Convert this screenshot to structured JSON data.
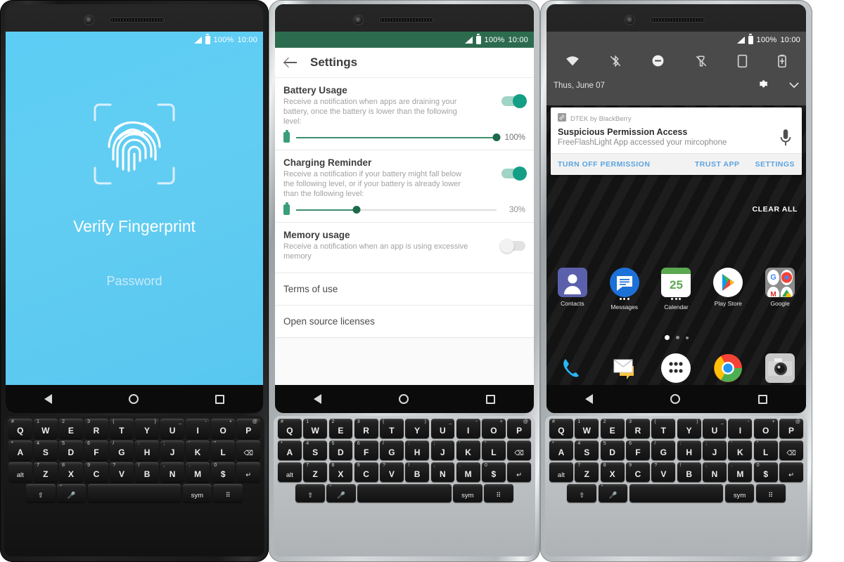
{
  "phones": [
    {
      "id": "phone-lockscreen",
      "finish": "black",
      "statusbar": {
        "battery_percent": "100%",
        "time": "10:00"
      },
      "screen": {
        "type": "lockscreen",
        "icon": "fingerprint-icon",
        "title": "Verify Fingerprint",
        "password_link": "Password",
        "background_color": "#5ccdf5"
      }
    },
    {
      "id": "phone-settings",
      "finish": "silver",
      "statusbar": {
        "battery_percent": "100%",
        "time": "10:00",
        "bar_color": "#2d6b4f"
      },
      "screen": {
        "type": "settings",
        "appbar": {
          "back_icon": "arrow-back-icon",
          "title": "Settings"
        },
        "items": [
          {
            "title": "Battery Usage",
            "description": "Receive a notification when apps are draining your battery, once the battery is lower than the following level:",
            "toggle": "on",
            "slider": {
              "value": 100,
              "label": "100%"
            }
          },
          {
            "title": "Charging Reminder",
            "description": "Receive a notification if your battery might fall below the following level, or if your battery is already lower than the following level:",
            "toggle": "on",
            "slider": {
              "value": 30,
              "label": "30%"
            }
          },
          {
            "title": "Memory usage",
            "description": "Receive a notification when an app is using excessive memory",
            "toggle": "off"
          }
        ],
        "links": [
          "Terms of use",
          "Open source licenses"
        ]
      }
    },
    {
      "id": "phone-notification-shade",
      "finish": "silver",
      "statusbar": {
        "battery_percent": "100%",
        "time": "10:00"
      },
      "screen": {
        "type": "home-with-shade",
        "quick_settings": {
          "icons": [
            "wifi-icon",
            "bluetooth-off-icon",
            "do-not-disturb-icon",
            "flashlight-off-icon",
            "auto-rotate-icon",
            "battery-saver-icon"
          ],
          "date": "Thus, June 07",
          "settings_icon": "gear-icon",
          "expand_icon": "chevron-down-icon"
        },
        "notification": {
          "app_icon": "dtek-icon",
          "app_name": "DTEK by BlackBerry",
          "title": "Suspicious Permission Access",
          "text": "FreeFlashLight App accessed your mircophone",
          "large_icon": "microphone-icon",
          "actions": [
            "TURN OFF PERMISSION",
            "TRUST APP",
            "SETTINGS"
          ]
        },
        "clear_all": "CLEAR ALL",
        "apps_row1": [
          {
            "label": "Contacts",
            "icon": "contacts-icon",
            "badge": false
          },
          {
            "label": "Messages",
            "icon": "messages-icon",
            "badge": true
          },
          {
            "label": "Calendar",
            "icon": "calendar-icon",
            "badge": true,
            "day": "25"
          },
          {
            "label": "Play Store",
            "icon": "play-store-icon",
            "badge": false
          },
          {
            "label": "Google",
            "icon": "google-folder-icon",
            "badge": false
          }
        ],
        "dock": [
          {
            "label": "",
            "icon": "phone-icon",
            "badge": false
          },
          {
            "label": "",
            "icon": "email-icon",
            "badge": true
          },
          {
            "label": "",
            "icon": "app-drawer-icon",
            "badge": false
          },
          {
            "label": "",
            "icon": "chrome-icon",
            "badge": true
          },
          {
            "label": "",
            "icon": "camera-icon",
            "badge": false
          }
        ],
        "page_dots": 3,
        "active_page": 0
      }
    }
  ],
  "keyboard": {
    "rows": [
      [
        {
          "main": "Q",
          "alt": "#"
        },
        {
          "main": "W",
          "alt": "1"
        },
        {
          "main": "E",
          "alt": "2"
        },
        {
          "main": "R",
          "alt": "3"
        },
        {
          "main": "T",
          "alt": "("
        },
        {
          "main": "Y",
          "alt": ")"
        },
        {
          "main": "U",
          "alt": "_"
        },
        {
          "main": "I",
          "alt": "-"
        },
        {
          "main": "O",
          "alt": "+"
        },
        {
          "main": "P",
          "alt": "@"
        }
      ],
      [
        {
          "main": "A",
          "alt": "*"
        },
        {
          "main": "S",
          "alt": "4"
        },
        {
          "main": "D",
          "alt": "5"
        },
        {
          "main": "F",
          "alt": "6"
        },
        {
          "main": "G",
          "alt": "/"
        },
        {
          "main": "H",
          "alt": ":"
        },
        {
          "main": "J",
          "alt": ";"
        },
        {
          "main": "K",
          "alt": "'"
        },
        {
          "main": "L",
          "alt": "\""
        },
        {
          "main": "⌫",
          "alt": "",
          "small": true
        }
      ],
      [
        {
          "main": "alt",
          "alt": "",
          "small": true
        },
        {
          "main": "Z",
          "alt": "7"
        },
        {
          "main": "X",
          "alt": "8"
        },
        {
          "main": "C",
          "alt": "9"
        },
        {
          "main": "V",
          "alt": "?"
        },
        {
          "main": "B",
          "alt": "!"
        },
        {
          "main": "N",
          "alt": ","
        },
        {
          "main": "M",
          "alt": "."
        },
        {
          "main": "$",
          "alt": "0"
        },
        {
          "main": "↵",
          "alt": "",
          "small": true
        }
      ],
      [
        {
          "main": "⇧",
          "alt": "",
          "small": true
        },
        {
          "main": "🎤",
          "alt": "°",
          "small": true
        },
        {
          "main": "",
          "alt": "",
          "space": true
        },
        {
          "main": "sym",
          "alt": "",
          "small": true
        },
        {
          "main": "⠿",
          "alt": "",
          "small": true
        }
      ]
    ]
  },
  "navbar": {
    "back": "back-icon",
    "home": "home-icon",
    "recents": "recents-icon"
  }
}
